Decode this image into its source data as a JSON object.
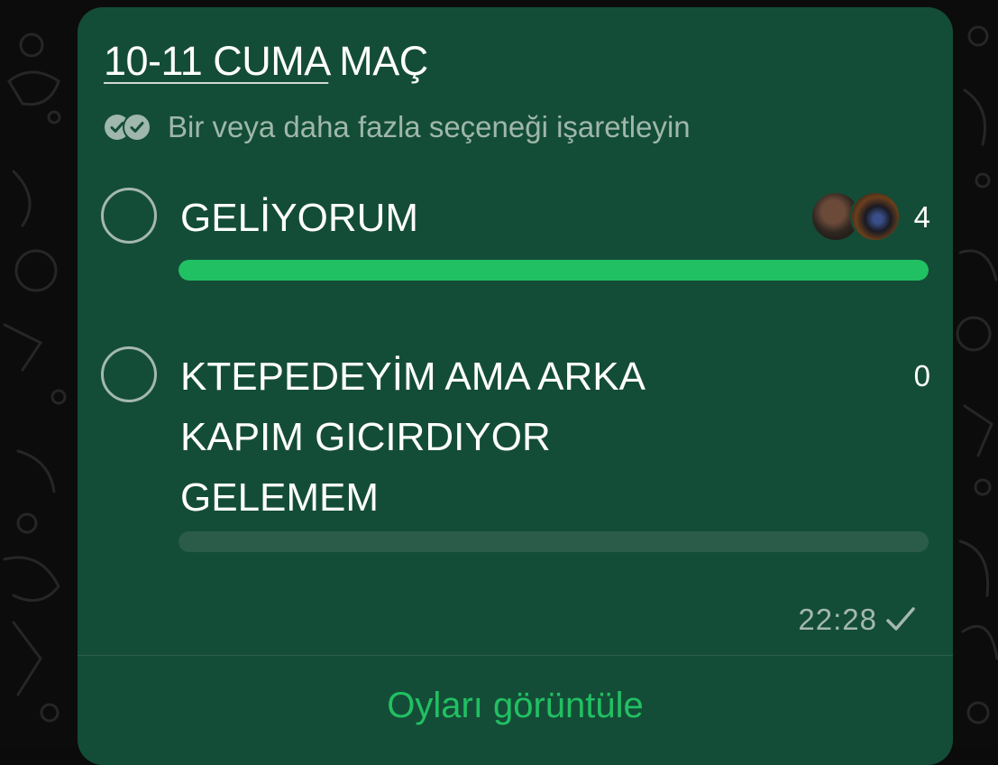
{
  "poll": {
    "title_underlined": "10-11 CUMA",
    "title_rest": " MAÇ",
    "subtitle": "Bir veya daha fazla seçeneği işaretleyin",
    "subtitle_icon": "double-check-circle-icon",
    "options": [
      {
        "text": "GELİYORUM",
        "count": "4",
        "fraction": 1.0,
        "has_avatars": true
      },
      {
        "text": "KTEPEDEYİM AMA ARKA KAPIM GICIRDIYOR GELEMEM",
        "count": "0",
        "fraction": 0.0,
        "has_avatars": false
      }
    ],
    "time": "22:28",
    "status_icon": "single-check-icon",
    "view_votes_label": "Oyları görüntüle"
  },
  "colors": {
    "bubble": "#144d37",
    "accent": "#21c063",
    "bar_track": "#2b5c49",
    "muted_text": "#a4b8b0",
    "wallpaper": "#0c0c0c"
  }
}
